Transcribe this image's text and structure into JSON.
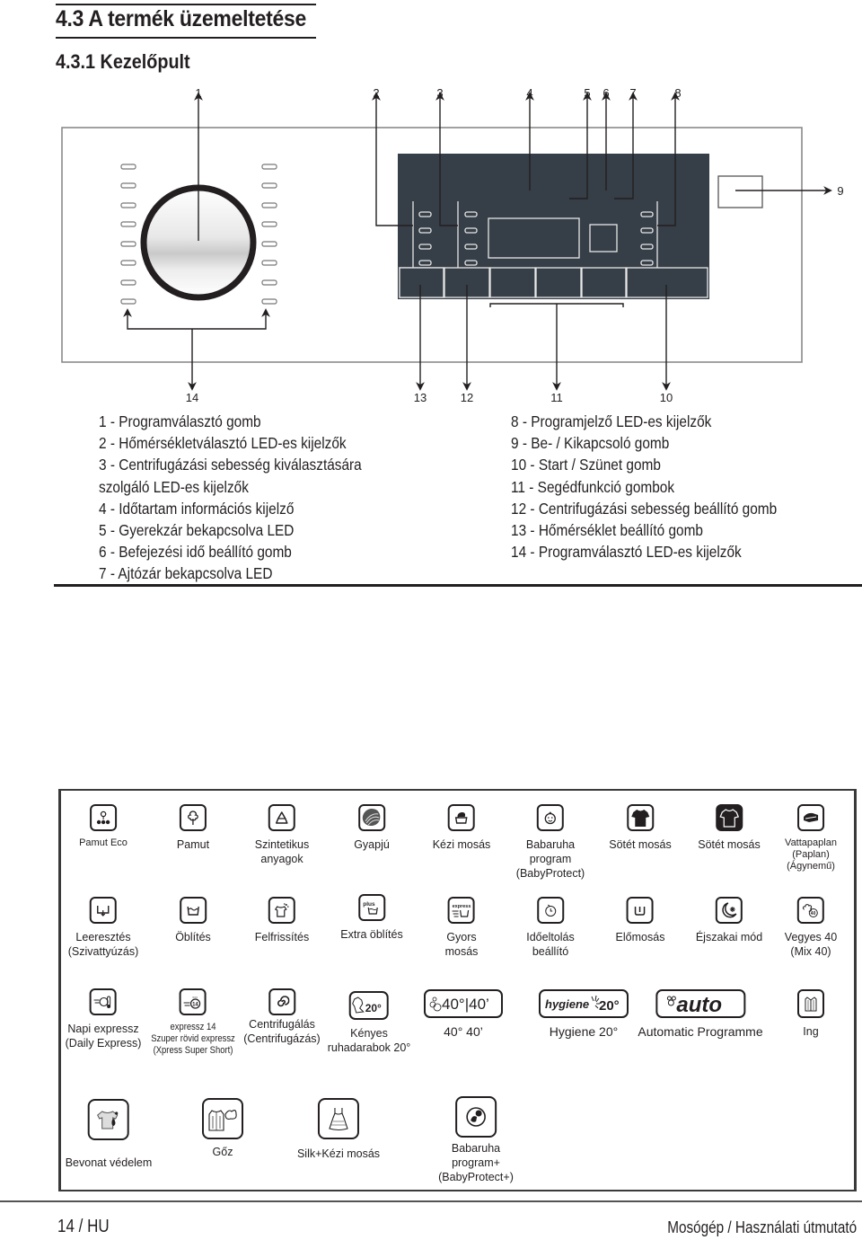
{
  "header": {
    "section_title": "4.3  A termék üzemeltetése",
    "subsection_title": "4.3.1 Kezelőpult"
  },
  "diagram": {
    "callouts_top": [
      "1",
      "2",
      "3",
      "4",
      "5",
      "6",
      "7",
      "8"
    ],
    "callout_right": "9",
    "callouts_bottom": [
      "14",
      "13",
      "12",
      "11",
      "10"
    ],
    "colors": {
      "panel": "#363e47",
      "frame": "#8a8a8a",
      "line": "#231f20"
    }
  },
  "legend": {
    "left": [
      "1 - Programválasztó gomb",
      "2 - Hőmérsékletválasztó LED-es kijelzők",
      "3 - Centrifugázási sebesség kiválasztására",
      "szolgáló LED-es kijelzők",
      "4 - Időtartam információs kijelző",
      "5 - Gyerekzár bekapcsolva LED",
      "6 - Befejezési idő beállító gomb",
      "7 - Ajtózár bekapcsolva LED"
    ],
    "right": [
      "8 - Programjelző LED-es kijelzők",
      "9 - Be- / Kikapcsoló gomb",
      "10 - Start / Szünet gomb",
      "11 - Segédfunkció gombok",
      "12 - Centrifugázási sebesség beállító gomb",
      "13 - Hőmérséklet beállító gomb",
      "14 - Programválasztó LED-es kijelzők"
    ]
  },
  "symbols": {
    "row1": [
      {
        "icon": "cotton-eco-icon",
        "label": [
          "Pamut Eco"
        ]
      },
      {
        "icon": "cotton-icon",
        "label": [
          "Pamut"
        ]
      },
      {
        "icon": "synthetics-icon",
        "label": [
          "Szintetikus",
          "anyagok"
        ]
      },
      {
        "icon": "wool-icon",
        "label": [
          "Gyapjú"
        ]
      },
      {
        "icon": "hand-wash-icon",
        "label": [
          "Kézi mosás"
        ]
      },
      {
        "icon": "baby-icon",
        "label": [
          "Babaruha",
          "program",
          "(BabyProtect)"
        ]
      },
      {
        "icon": "dark-shirt-icon",
        "label": [
          "Sötét mosás"
        ]
      },
      {
        "icon": "dark-shirt-outline-icon",
        "label": [
          "Sötét mosás"
        ]
      },
      {
        "icon": "duvet-icon",
        "label": [
          "Vattapaplan",
          "(Paplan)",
          "(Ágynemű)"
        ]
      }
    ],
    "row2": [
      {
        "icon": "drain-icon",
        "label": [
          "Leeresztés",
          "(Szivattyúzás)"
        ]
      },
      {
        "icon": "rinse-icon",
        "label": [
          "Öblítés"
        ]
      },
      {
        "icon": "refresh-icon",
        "label": [
          "Felfrissítés"
        ]
      },
      {
        "icon": "rinse-plus-icon",
        "label": [
          "Extra öblítés"
        ],
        "badge": "plus"
      },
      {
        "icon": "express-icon",
        "label": [
          "Gyors",
          "mosás"
        ],
        "badge": "express"
      },
      {
        "icon": "delay-timer-icon",
        "label": [
          "Időeltolás",
          "beállító"
        ]
      },
      {
        "icon": "prewash-icon",
        "label": [
          "Előmosás"
        ]
      },
      {
        "icon": "night-mode-icon",
        "label": [
          "Éjszakai mód"
        ]
      },
      {
        "icon": "mix40-icon",
        "label": [
          "Vegyes 40",
          "(Mix 40)"
        ]
      }
    ],
    "row3": [
      {
        "icon": "daily-express-icon",
        "label": [
          "Napi expressz",
          "(Daily Express)"
        ]
      },
      {
        "icon": "express14-icon",
        "label": [
          "expressz 14",
          "Szuper rövid expressz",
          "(Xpress Super Short)"
        ],
        "badge": "14"
      },
      {
        "icon": "spin-icon",
        "label": [
          "Centrifugálás",
          "(Centrifugázás)"
        ]
      },
      {
        "icon": "delicates20-icon",
        "label": [
          "Kényes",
          "ruhadarabok 20°"
        ],
        "badge": "20°"
      },
      {
        "icon": "40-40-icon",
        "label": [
          "40° 40’"
        ],
        "badge": "40°|40’"
      },
      {
        "icon": "hygiene20-icon",
        "label": [
          "Hygiene 20°"
        ],
        "badge_word": "hygiene",
        "badge": "20°"
      },
      {
        "icon": "auto-icon",
        "label": [
          "Automatic Programme"
        ],
        "badge": "auto"
      },
      {
        "icon": "shirt-icon",
        "label": [
          "Ing"
        ]
      }
    ],
    "row4": [
      {
        "icon": "coat-protection-icon",
        "label": [
          "Bevonat védelem"
        ]
      },
      {
        "icon": "steam-icon",
        "label": [
          "Gőz"
        ]
      },
      {
        "icon": "silk-hand-wash-icon",
        "label": [
          "Silk+Kézi mosás"
        ]
      },
      {
        "icon": "baby-plus-icon",
        "label": [
          "Babaruha",
          "program+",
          "(BabyProtect+)"
        ]
      }
    ]
  },
  "footer": {
    "page": "14 / HU",
    "doc_title": "Mosógép / Használati útmutató"
  }
}
